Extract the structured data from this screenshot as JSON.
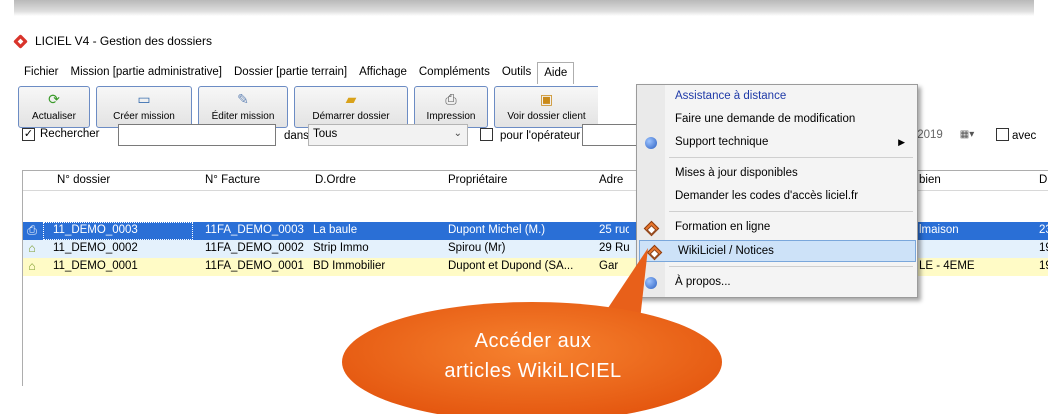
{
  "window": {
    "title": "LICIEL V4 - Gestion des dossiers"
  },
  "menubar": [
    "Fichier",
    "Mission [partie administrative]",
    "Dossier [partie terrain]",
    "Affichage",
    "Compléments",
    "Outils",
    "Aide"
  ],
  "toolbar": {
    "actualiser": "Actualiser",
    "creer_mission": "Créer mission",
    "editer_mission": "Éditer mission",
    "demarrer_dossier": "Démarrer dossier",
    "impression": "Impression",
    "voir_dossier_client": "Voir dossier client"
  },
  "search": {
    "checkbox_label": "Rechercher",
    "checked": true,
    "dans_label": "dans",
    "scope_value": "Tous",
    "operator_label": "pour l'opérateur",
    "date_fragment": "/2019",
    "avec_label": "avec"
  },
  "table": {
    "headers": [
      "N° dossier",
      "N° Facture",
      "D.Ordre",
      "Propriétaire",
      "Adre",
      "bien",
      "D"
    ],
    "rows": [
      [
        "11_DEMO_0003",
        "11FA_DEMO_0003",
        "La baule",
        "Dupont Michel (M.)",
        "25 ruc",
        "lmaison",
        "23"
      ],
      [
        "11_DEMO_0002",
        "11FA_DEMO_0002",
        "Strip Immo",
        "Spirou (Mr)",
        "29 Ru",
        "",
        "19"
      ],
      [
        "11_DEMO_0001",
        "11FA_DEMO_0001",
        "BD Immobilier",
        "Dupont et Dupond (SA...",
        "Gar",
        "LE - 4EME",
        "19"
      ]
    ]
  },
  "aide_menu": {
    "assistance": "Assistance à distance",
    "demande_modif": "Faire une demande de modification",
    "support": "Support technique",
    "mises_a_jour": "Mises à jour disponibles",
    "codes_acces": "Demander les codes d'accès liciel.fr",
    "formation": "Formation en ligne",
    "wikiliciel": "WikiLiciel / Notices",
    "a_propos": "À propos..."
  },
  "callout": {
    "line1": "Accéder aux",
    "line2": "articles WikiLICIEL",
    "color": "#f06a1f"
  }
}
